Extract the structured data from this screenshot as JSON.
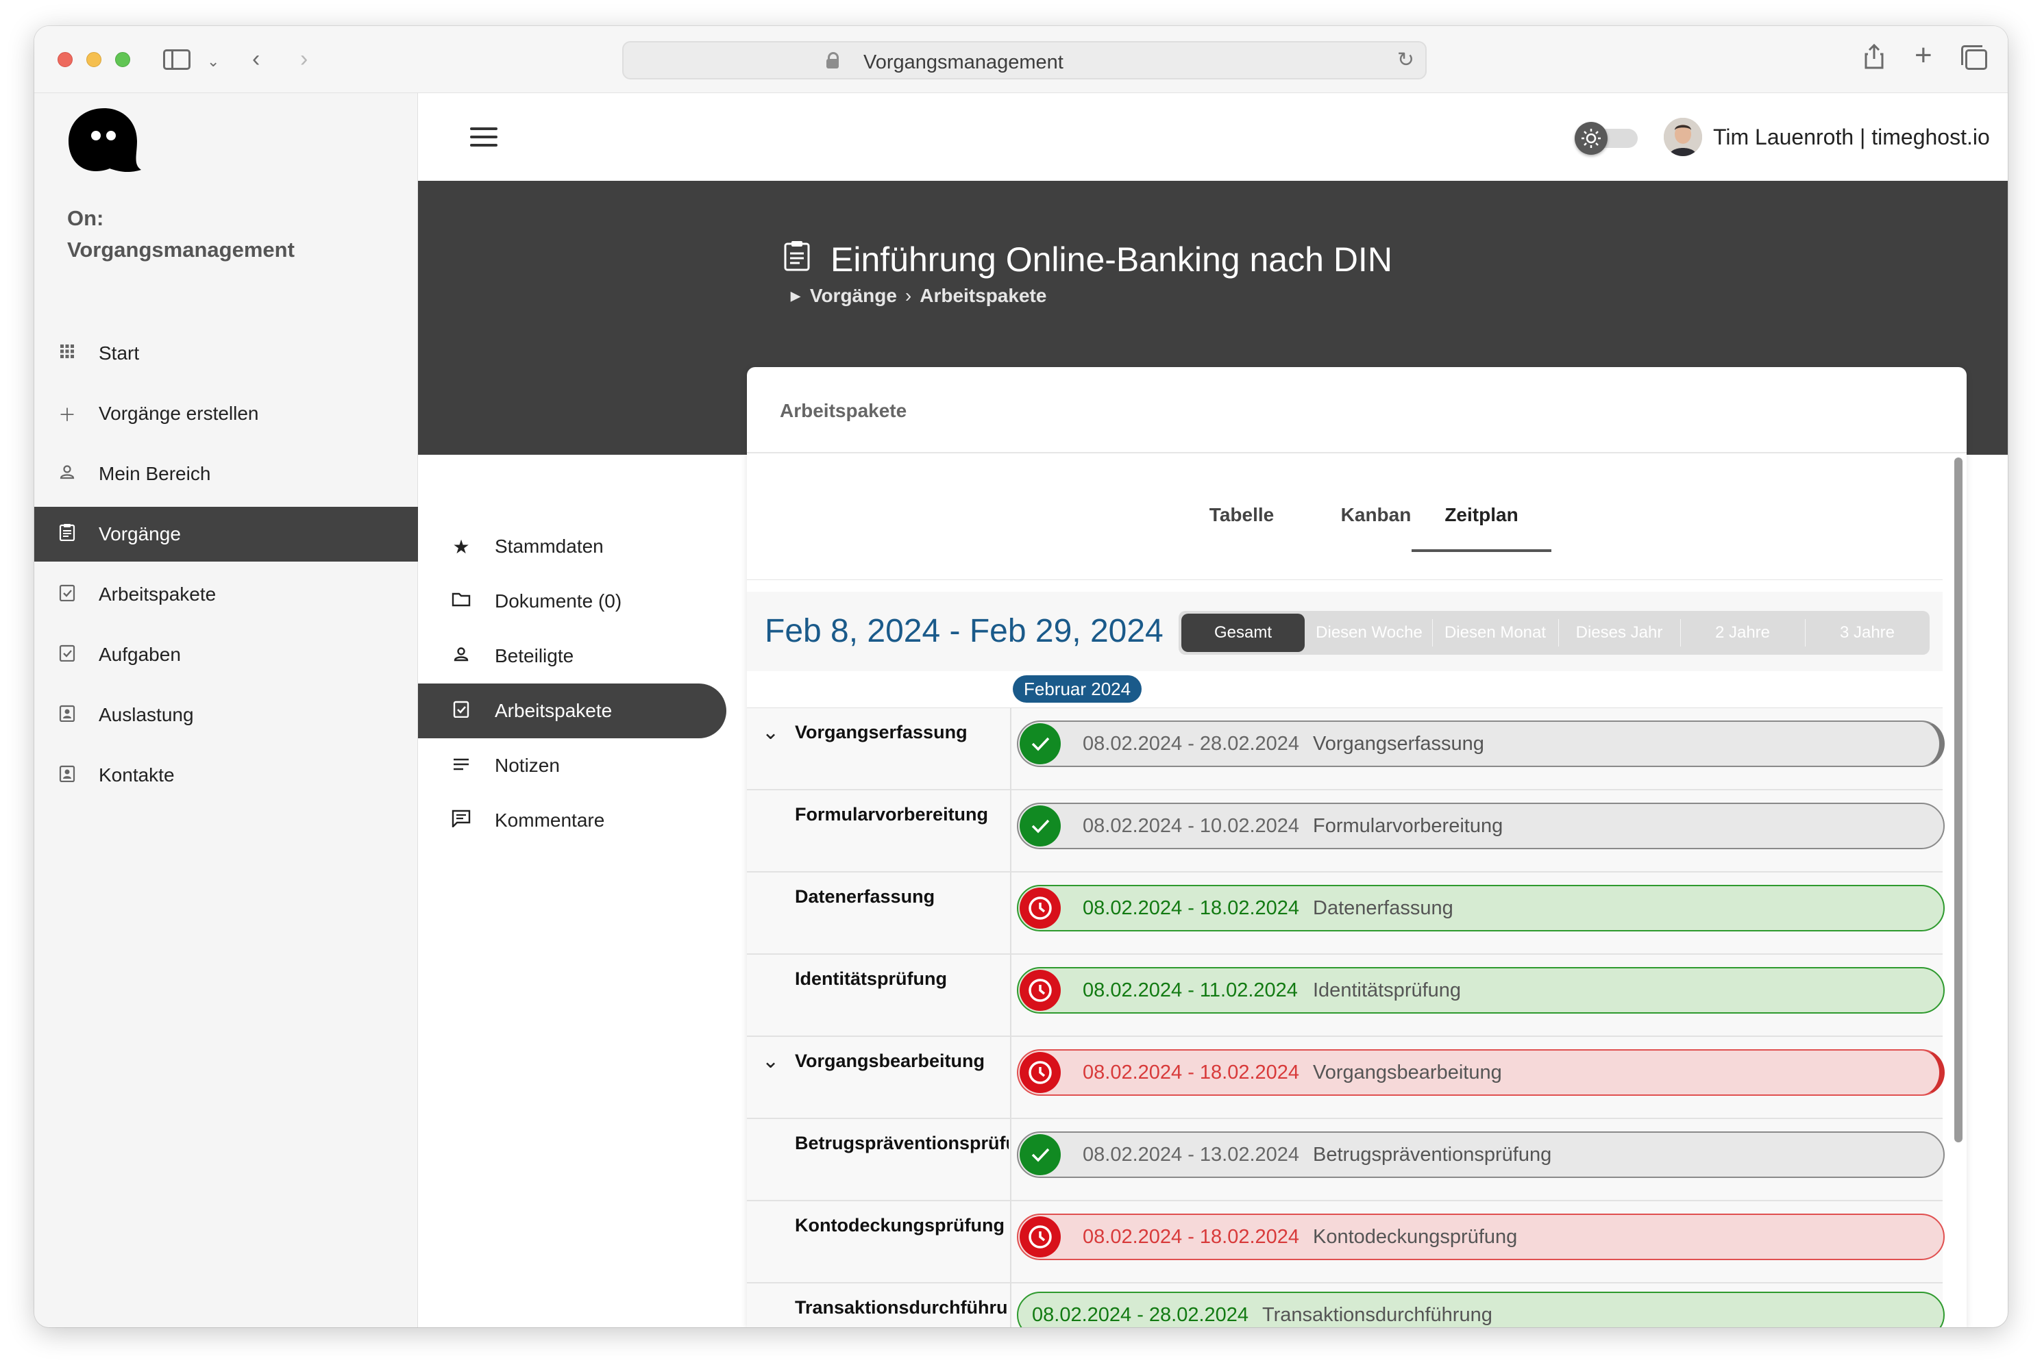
{
  "browser": {
    "url": "Vorgangsmanagement"
  },
  "sidebar": {
    "app_name_line1": "On:",
    "app_name_line2": "Vorgangsmanagement",
    "items": [
      {
        "label": "Start",
        "icon": "grid-icon"
      },
      {
        "label": "Vorgänge erstellen",
        "icon": "plus-icon"
      },
      {
        "label": "Mein Bereich",
        "icon": "person-icon"
      },
      {
        "label": "Vorgänge",
        "icon": "clipboard-icon",
        "active": true
      },
      {
        "label": "Arbeitspakete",
        "icon": "checkbox-icon"
      },
      {
        "label": "Aufgaben",
        "icon": "checkbox-icon"
      },
      {
        "label": "Auslastung",
        "icon": "contact-card-icon"
      },
      {
        "label": "Kontakte",
        "icon": "contact-card-icon"
      }
    ]
  },
  "topbar": {
    "user": "Tim Lauenroth | timeghost.io",
    "theme_toggle_on": false
  },
  "header": {
    "title": "Einführung Online-Banking nach DIN",
    "breadcrumb": [
      "Vorgänge",
      "Arbeitspakete"
    ]
  },
  "subnav": {
    "items": [
      {
        "label": "Stammdaten",
        "icon": "star-icon"
      },
      {
        "label": "Dokumente (0)",
        "icon": "folder-icon"
      },
      {
        "label": "Beteiligte",
        "icon": "person-icon"
      },
      {
        "label": "Arbeitspakete",
        "icon": "checkbox-icon",
        "active": true
      },
      {
        "label": "Notizen",
        "icon": "lines-icon"
      },
      {
        "label": "Kommentare",
        "icon": "comment-icon"
      }
    ]
  },
  "card": {
    "title": "Arbeitspakete",
    "tabs": [
      "Tabelle",
      "Kanban",
      "Zeitplan"
    ],
    "selected_tab": "Zeitplan"
  },
  "schedule": {
    "date_range": "Feb 8, 2024 - Feb 29, 2024",
    "ranges": [
      "Gesamt",
      "Diesen Woche",
      "Diesen Monat",
      "Dieses Jahr",
      "2 Jahre",
      "3 Jahre"
    ],
    "selected_range": "Gesamt",
    "month_label": "Februar 2024",
    "rows": [
      {
        "label": "Vorgangserfassung",
        "group": true,
        "dates": "08.02.2024 - 28.02.2024",
        "name": "Vorgangserfassung",
        "status": "done",
        "style": "grey"
      },
      {
        "label": "Formularvorbereitung",
        "group": false,
        "dates": "08.02.2024 - 10.02.2024",
        "name": "Formularvorbereitung",
        "status": "done",
        "style": "grey"
      },
      {
        "label": "Datenerfassung",
        "group": false,
        "dates": "08.02.2024 - 18.02.2024",
        "name": "Datenerfassung",
        "status": "overdue",
        "style": "green"
      },
      {
        "label": "Identitätsprüfung",
        "group": false,
        "dates": "08.02.2024 - 11.02.2024",
        "name": "Identitätsprüfung",
        "status": "overdue",
        "style": "green"
      },
      {
        "label": "Vorgangsbearbeitung",
        "group": true,
        "dates": "08.02.2024 - 18.02.2024",
        "name": "Vorgangsbearbeitung",
        "status": "overdue",
        "style": "red"
      },
      {
        "label": "Betrugspräventionsprüfu",
        "group": false,
        "dates": "08.02.2024 - 13.02.2024",
        "name": "Betrugspräventionsprüfung",
        "status": "done",
        "style": "grey"
      },
      {
        "label": "Kontodeckungsprüfung",
        "group": false,
        "dates": "08.02.2024 - 18.02.2024",
        "name": "Kontodeckungsprüfung",
        "status": "overdue",
        "style": "red"
      },
      {
        "label": "Transaktionsdurchführun",
        "group": false,
        "dates": "08.02.2024 - 28.02.2024",
        "name": "Transaktionsdurchführung",
        "status": "none",
        "style": "green"
      }
    ]
  },
  "colors": {
    "accent_blue": "#1a5a8a",
    "dark": "#404040",
    "ok_green": "#118a22",
    "late_red": "#d8101a"
  }
}
